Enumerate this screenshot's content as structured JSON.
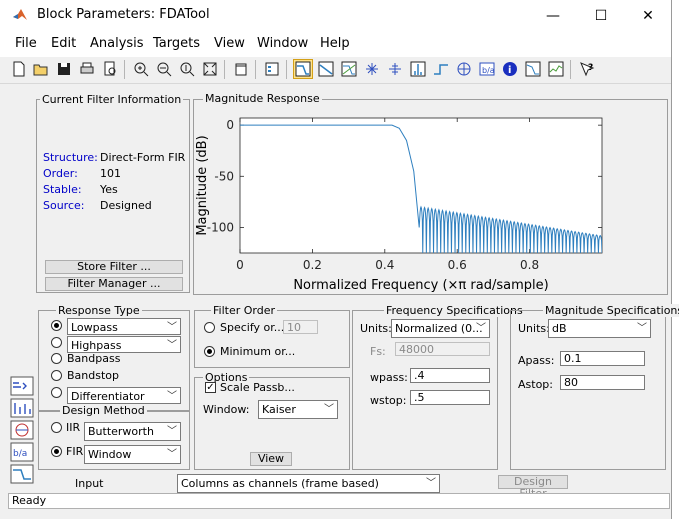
{
  "window": {
    "title": "Block Parameters: FDATool",
    "controls": {
      "minimize": "—",
      "maximize": "☐",
      "close": "✕"
    }
  },
  "menu": [
    "File",
    "Edit",
    "Analysis",
    "Targets",
    "View",
    "Window",
    "Help"
  ],
  "toolbar_icons": [
    "new-file-icon",
    "open-folder-icon",
    "save-icon",
    "print-icon",
    "print-preview-icon",
    "zoom-in-icon",
    "zoom-x-icon",
    "zoom-y-icon",
    "full-view-icon",
    "new-window-icon",
    "legend-icon",
    "magnitude-response-icon",
    "phase-response-icon",
    "magnitude-phase-icon",
    "group-delay-icon",
    "phase-delay-icon",
    "impulse-response-icon",
    "step-response-icon",
    "pole-zero-icon",
    "filter-coefficients-icon",
    "filter-info-icon",
    "magnitude-estimate-icon",
    "noise-power-icon",
    "whats-this-icon"
  ],
  "current_filter": {
    "title": "Current Filter Information",
    "rows": [
      {
        "label": "Structure:",
        "value": "Direct-Form FIR"
      },
      {
        "label": "Order:",
        "value": "101"
      },
      {
        "label": "Stable:",
        "value": "Yes"
      },
      {
        "label": "Source:",
        "value": "Designed"
      }
    ],
    "store_button": "Store Filter ...",
    "manager_button": "Filter Manager ..."
  },
  "magnitude_panel": {
    "title": "Magnitude Response"
  },
  "chart_data": {
    "type": "line",
    "xlabel": "Normalized Frequency (×π rad/sample)",
    "ylabel": "Magnitude (dB)",
    "xlim": [
      0,
      1
    ],
    "ylim": [
      -125,
      7
    ],
    "x_ticks": [
      0,
      0.2,
      0.4,
      0.6,
      0.8
    ],
    "x_tick_labels": [
      "0",
      "0.2",
      "0.4",
      "0.6",
      "0.8"
    ],
    "y_ticks": [
      0,
      -50,
      -100
    ],
    "y_tick_labels": [
      "0",
      "-50",
      "-100"
    ],
    "grid": false,
    "series": [
      {
        "color": "#2e7fbf",
        "passband": {
          "x": [
            0,
            0.42
          ],
          "y": [
            0,
            0
          ]
        },
        "transition": {
          "x": [
            0.42,
            0.44,
            0.46,
            0.48,
            0.495
          ],
          "y": [
            0,
            -3,
            -15,
            -45,
            -100
          ]
        },
        "stopband_x": [
          0.495,
          1.0
        ],
        "stopband_sidelobe_peak_start": -80,
        "stopband_sidelobe_peak_end": -108,
        "stopband_lobe_count": 51,
        "stopband_null_floor": -125
      }
    ]
  },
  "response_type": {
    "title": "Response Type",
    "options": [
      {
        "label": "Lowpass",
        "selected": true,
        "dropdown": "Lowpass"
      },
      {
        "label": "Highpass",
        "selected": false,
        "dropdown": "Highpass"
      },
      {
        "label": "Bandpass",
        "selected": false
      },
      {
        "label": "Bandstop",
        "selected": false
      },
      {
        "label": "",
        "selected": false,
        "dropdown": "Differentiator"
      }
    ]
  },
  "design_method": {
    "title": "Design Method",
    "options": [
      {
        "label": "IIR",
        "selected": false,
        "dropdown": "Butterworth"
      },
      {
        "label": "FIR",
        "selected": true,
        "dropdown": "Window"
      }
    ]
  },
  "filter_order": {
    "title": "Filter Order",
    "specify_label": "Specify or...",
    "specify_value": "10",
    "minimum_label": "Minimum or..."
  },
  "options": {
    "title": "Options",
    "scale_label": "Scale Passb...",
    "scale_checked": true,
    "window_label": "Window:",
    "window_value": "Kaiser",
    "view_button": "View"
  },
  "frequency_specs": {
    "title": "Frequency Specifications",
    "units_label": "Units:",
    "units_value": "Normalized (0...",
    "fs_label": "Fs:",
    "fs_value": "48000",
    "wpass_label": "wpass:",
    "wpass_value": ".4",
    "wstop_label": "wstop:",
    "wstop_value": ".5"
  },
  "magnitude_specs": {
    "title": "Magnitude Specifications",
    "units_label": "Units:",
    "units_value": "dB",
    "apass_label": "Apass:",
    "apass_value": "0.1",
    "astop_label": "Astop:",
    "astop_value": "80"
  },
  "bottom": {
    "input_label": "Input",
    "input_value": "Columns as channels (frame based)",
    "design_button": "Design Filter"
  },
  "status": "Ready",
  "side_icons": [
    "transform-filter-icon",
    "create-multirate-icon",
    "realize-model-icon",
    "pole-zero-editor-icon",
    "import-filter-icon",
    "design-filter-icon"
  ]
}
